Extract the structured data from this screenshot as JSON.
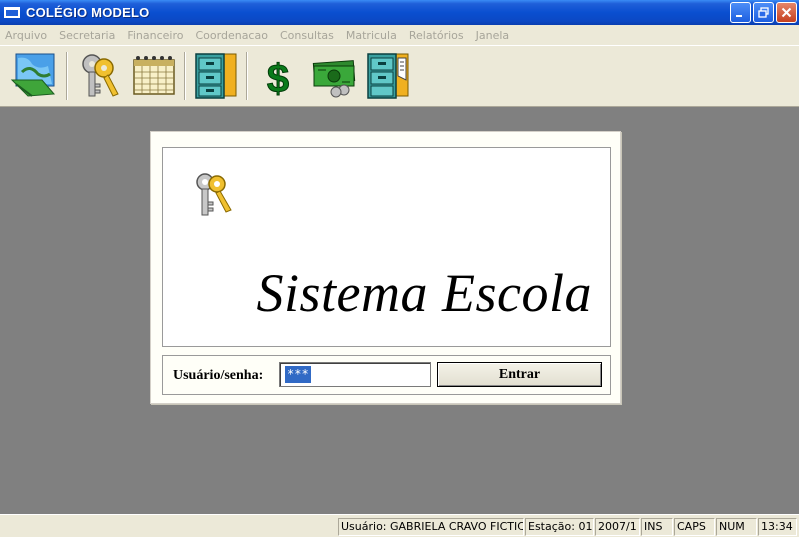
{
  "window": {
    "title": "COLÉGIO MODELO"
  },
  "title_buttons": {
    "minimize": "_",
    "restore": "❐",
    "close": "✕"
  },
  "menu": [
    "Arquivo",
    "Secretaria",
    "Financeiro",
    "Coordenacao",
    "Consultas",
    "Matricula",
    "Relatórios",
    "Janela"
  ],
  "toolbar": {
    "icons": [
      "exit-map-icon",
      "keys-icon",
      "calendar-icon",
      "file-cabinet-icon",
      "dollar-icon",
      "money-icon",
      "file-cabinet-open-icon"
    ]
  },
  "login": {
    "banner_title": "Sistema Escola",
    "label": "Usuário/senha:",
    "password_value": "***",
    "button_label": "Entrar"
  },
  "status": {
    "user": "Usuário: GABRIELA CRAVO FICTICIO",
    "station": "Estação: 01",
    "period": "2007/1",
    "ins": "INS",
    "caps": "CAPS",
    "num": "NUM",
    "time": "13:34"
  },
  "colors": {
    "titlebar": "#0a4fd0",
    "workspace": "#808080",
    "chrome": "#ece9d8",
    "selection": "#316ac5"
  }
}
